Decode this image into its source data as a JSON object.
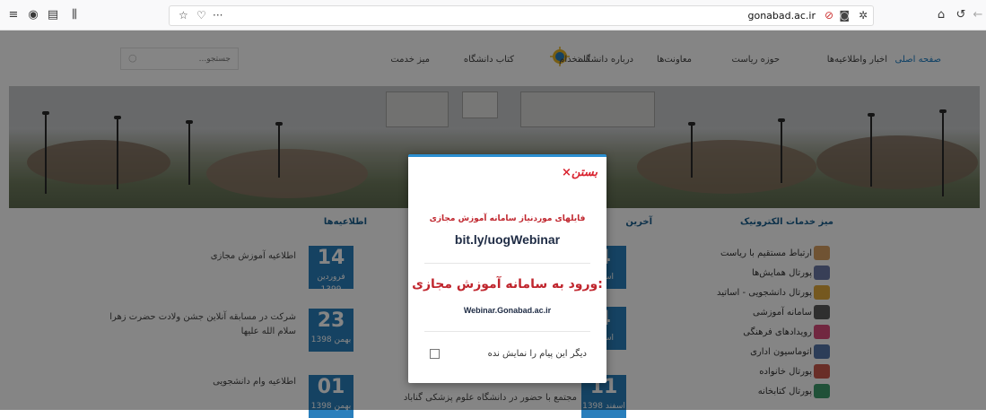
{
  "browser": {
    "url": "gonabad.ac.ir",
    "menu_icon": "hamburger-menu-icon",
    "icons": [
      "shield-icon",
      "sidebar-icon",
      "library-icon",
      "star-icon",
      "pocket-icon",
      "more-icon",
      "home-icon",
      "undo-icon",
      "back-icon"
    ]
  },
  "nav": {
    "items": [
      "صفحه اصلی",
      "اخبار واطلاعیه‌ها",
      "حوزه ریاست",
      "معاونت‌ها",
      "درباره دانشگاه",
      "استخدام",
      "کتاب دانشگاه",
      "میز خدمت"
    ],
    "search_placeholder": "جستجو..."
  },
  "content": {
    "col_services_title": "میز خدمات الکترونیک",
    "col_latest_title": "آخرین",
    "col_notices_title": "اطلاعیه‌ها",
    "services": [
      "ارتباط مستقیم با ریاست",
      "پورتال همایش‌ها",
      "پورتال دانشجویی - اساتید",
      "سامانه آموزشی",
      "رویدادهای فرهنگی",
      "اتوماسیون اداری",
      "پورتال خانواده",
      "پورتال کتابخانه"
    ],
    "notices": [
      {
        "day": "14",
        "month": "فروردین 1399",
        "text": "اطلاعیه آموزش مجازی"
      },
      {
        "day": "23",
        "month": "بهمن 1398",
        "text": "شرکت در مسابقه آنلاین جشن ولادت حضرت زهرا سلام الله علیها"
      },
      {
        "day": "01",
        "month": "بهمن 1398",
        "text": "اطلاعیه وام دانشجویی"
      }
    ],
    "latest": [
      {
        "day": "4",
        "month": "اسفند"
      },
      {
        "day": "4",
        "month": "اسفند"
      },
      {
        "day": "11",
        "month": "اسفند 1398",
        "text": "مجتمع با حضور در دانشگاه علوم پزشکی گناباد"
      }
    ]
  },
  "modal": {
    "close_label": "×بستن",
    "line1": "فایلهای موردنیاز سامانه آموزش مجازی",
    "link": "bit.ly/uogWebinar",
    "title2": "ورود به سامانه آموزش مجازی:",
    "url": "Webinar.Gonabad.ac.ir",
    "checkbox_label": "دیگر این پیام را نمایش نده",
    "accent": "#c0262e"
  }
}
